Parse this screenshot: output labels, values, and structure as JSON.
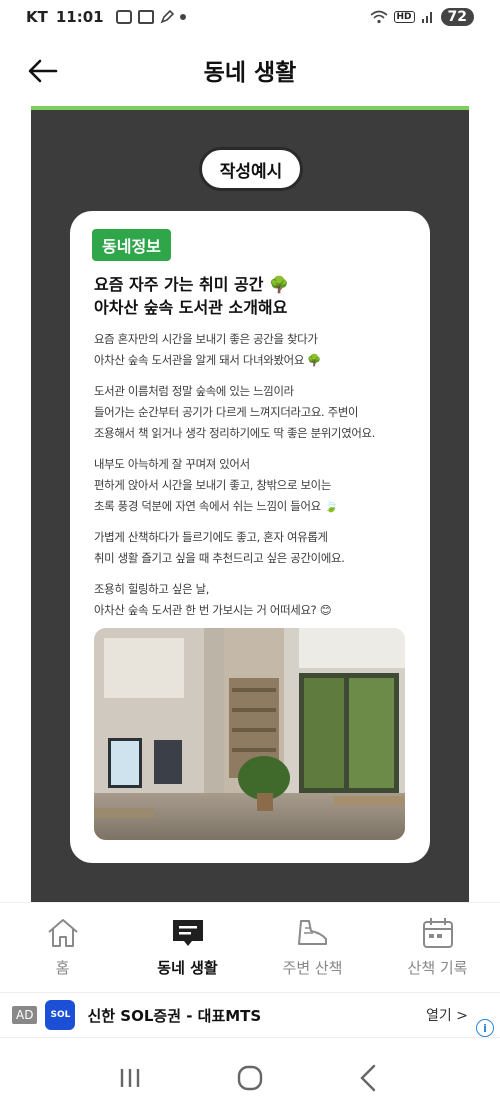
{
  "status_bar": {
    "carrier": "KT",
    "time": "11:01",
    "network": "HD",
    "battery": "72"
  },
  "header": {
    "title": "동네 생활"
  },
  "example_label": "작성예시",
  "post": {
    "tag": "동네정보",
    "title_line1": "요즘 자주 가는 취미 공간 🌳",
    "title_line2": "아차산 숲속 도서관 소개해요",
    "paragraphs": [
      "요즘 혼자만의 시간을 보내기 좋은 공간을 찾다가\n아차산 숲속 도서관을 알게 돼서 다녀와봤어요 🌳",
      "도서관 이름처럼 정말 숲속에 있는 느낌이라\n들어가는 순간부터 공기가 다르게 느껴지더라고요. 주변이\n조용해서 책 읽거나 생각 정리하기에도 딱 좋은 분위기였어요.",
      "내부도 아늑하게 잘 꾸며져 있어서\n편하게 앉아서 시간을 보내기 좋고, 창밖으로 보이는\n초록 풍경 덕분에 자연 속에서 쉬는 느낌이 들어요 🍃",
      "가볍게 산책하다가 들르기에도 좋고, 혼자 여유롭게\n취미 생활 즐기고 싶을 때 추천드리고 싶은 공간이에요.",
      "조용히 힐링하고 싶은 날,\n아차산 숲속 도서관 한 번 가보시는 거 어떠세요? 😊"
    ]
  },
  "bottom_nav": {
    "items": [
      {
        "label": "홈",
        "icon": "home-icon"
      },
      {
        "label": "동네 생활",
        "icon": "chat-board-icon"
      },
      {
        "label": "주변 산책",
        "icon": "shoe-icon"
      },
      {
        "label": "산책 기록",
        "icon": "calendar-icon"
      }
    ],
    "active_index": 1
  },
  "ad": {
    "badge": "AD",
    "logo_text": "SOL",
    "text": "신한 SOL증권 - 대표MTS",
    "open_label": "열기 >",
    "info_icon": "i"
  },
  "colors": {
    "accent_green": "#2fa64a",
    "header_line": "#7ccf5a",
    "panel_bg": "#3c3c3c"
  }
}
